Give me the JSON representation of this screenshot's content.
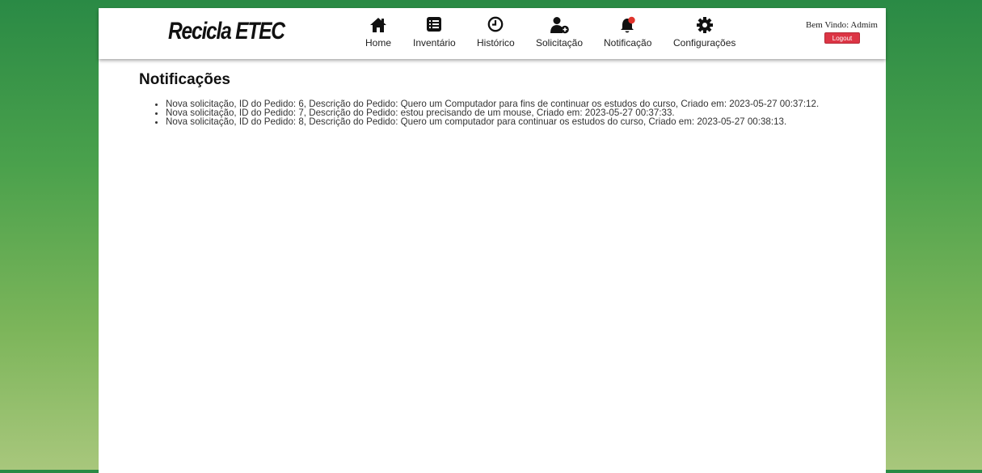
{
  "brand": {
    "logo_text": "Recicla ETEC"
  },
  "nav": {
    "items": [
      {
        "label": "Home",
        "icon": "home-icon"
      },
      {
        "label": "Inventário",
        "icon": "list-icon"
      },
      {
        "label": "Histórico",
        "icon": "clock-icon"
      },
      {
        "label": "Solicitação",
        "icon": "user-plus-icon"
      },
      {
        "label": "Notificação",
        "icon": "bell-alert-icon"
      },
      {
        "label": "Configurações",
        "icon": "gear-icon"
      }
    ]
  },
  "user": {
    "welcome": "Bem Vindo: Admim",
    "logout_label": "Logout"
  },
  "main": {
    "title": "Notificações",
    "notifications": [
      "Nova solicitação, ID do Pedido: 6, Descrição do Pedido: Quero um Computador para fins de continuar os estudos do curso, Criado em: 2023-05-27 00:37:12.",
      "Nova solicitação, ID do Pedido: 7, Descrição do Pedido: estou precisando de um mouse, Criado em: 2023-05-27 00:37:33.",
      "Nova solicitação, ID do Pedido: 8, Descrição do Pedido: Quero um computador para continuar os estudos do curso, Criado em: 2023-05-27 00:38:13."
    ]
  },
  "colors": {
    "accent": "#dc3545",
    "bg_top": "#2a8a45",
    "bg_bottom": "#a8c77c",
    "notification_dot": "#e0342c"
  }
}
